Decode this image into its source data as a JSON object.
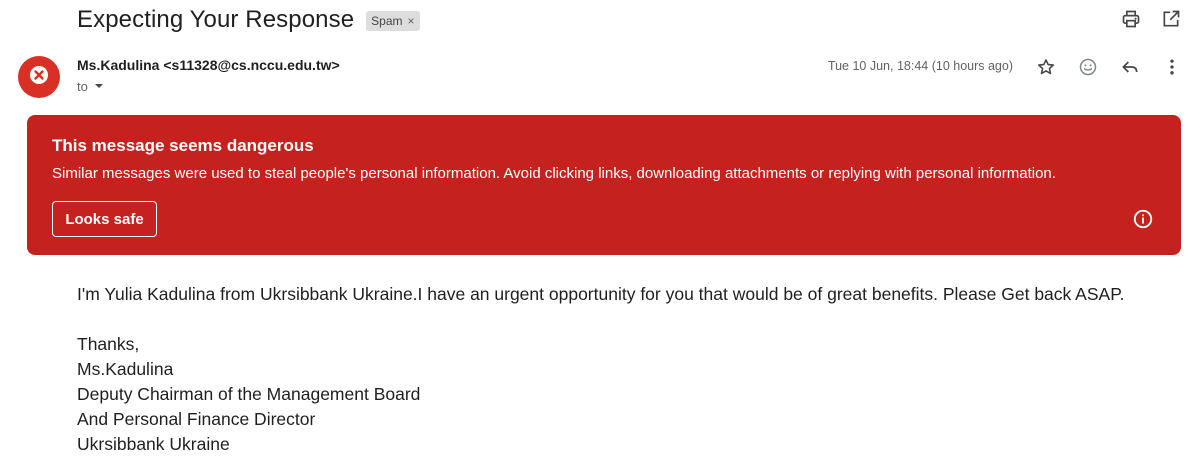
{
  "subject": "Expecting Your Response",
  "labels": {
    "spam_chip": "Spam",
    "spam_chip_remove": "×"
  },
  "header": {
    "sender_name": "Ms.Kadulina",
    "sender_email": "<s11328@cs.nccu.edu.tw>",
    "to_label": "to",
    "timestamp": "Tue 10 Jun, 18:44 (10 hours ago)"
  },
  "icons": {
    "top": [
      "print-icon",
      "open-in-new-window-icon"
    ],
    "actions": [
      "star-icon",
      "emoji-reaction-icon",
      "reply-icon",
      "more-options-icon"
    ],
    "avatar": "danger-x-icon",
    "banner": "info-icon"
  },
  "warning": {
    "title": "This message seems dangerous",
    "text": "Similar messages were used to steal people's personal information. Avoid clicking links, downloading attachments or replying with personal information.",
    "button_label": "Looks safe"
  },
  "body": {
    "paragraph": "I'm Yulia Kadulina from Ukrsibbank Ukraine.I have an urgent opportunity for you that would be of great benefits. Please Get back ASAP.",
    "signature": [
      "Thanks,",
      "Ms.Kadulina",
      "Deputy Chairman of the Management Board",
      "And Personal Finance Director",
      "Ukrsibbank Ukraine"
    ]
  },
  "colors": {
    "danger_background": "#c5221f",
    "avatar_background": "#d93025",
    "spam_chip_background": "#dddddd",
    "muted_text": "#5f6368"
  }
}
